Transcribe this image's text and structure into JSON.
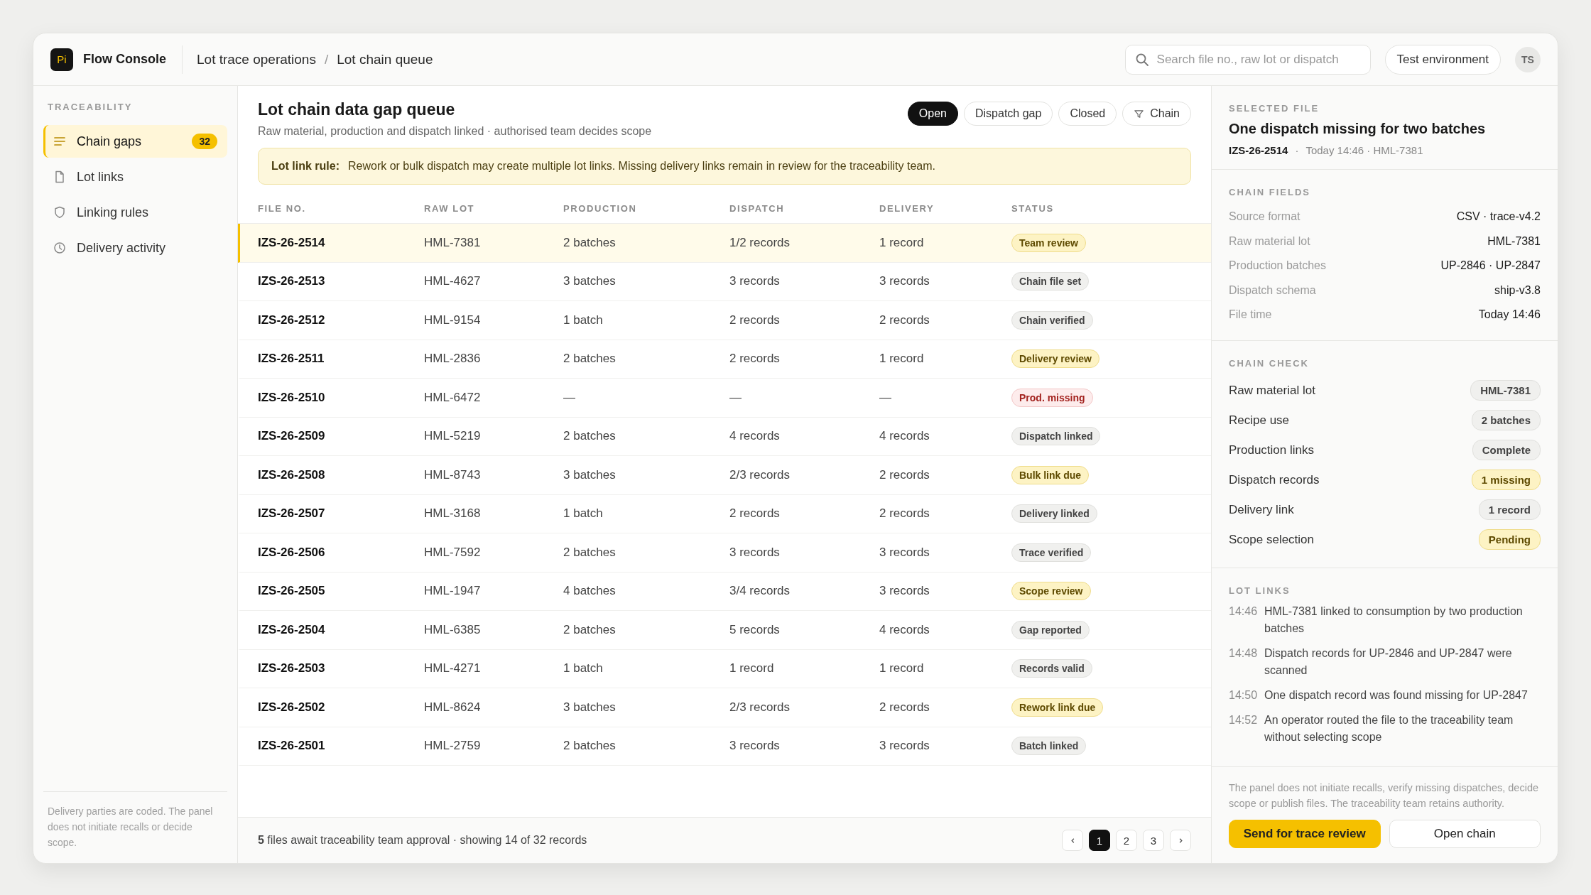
{
  "app": {
    "logo": "Pi",
    "name": "Flow Console"
  },
  "breadcrumb": {
    "separator": "/",
    "items": [
      "Lot trace operations",
      "Lot chain queue"
    ]
  },
  "search": {
    "placeholder": "Search file no., raw lot or dispatch"
  },
  "environment": "Test environment",
  "avatar": "TS",
  "sidebar": {
    "heading": "TRACEABILITY",
    "items": [
      {
        "label": "Chain gaps",
        "kind": "list",
        "selected": true,
        "count": "32"
      },
      {
        "label": "Lot links",
        "kind": "file",
        "selected": false
      },
      {
        "label": "Linking rules",
        "kind": "shield",
        "selected": false
      },
      {
        "label": "Delivery activity",
        "kind": "clock",
        "selected": false
      }
    ],
    "note": "Delivery parties are coded. The panel does not initiate recalls or decide scope."
  },
  "queue": {
    "title": "Lot chain data gap queue",
    "subtitle": "Raw material, production and dispatch linked · authorised team decides scope",
    "filters": [
      {
        "label": "Open",
        "selected": true
      },
      {
        "label": "Dispatch gap",
        "selected": false
      },
      {
        "label": "Closed",
        "selected": false
      },
      {
        "label": "Chain",
        "selected": false,
        "kind": "filter"
      }
    ],
    "rule": {
      "label": "Lot link rule:",
      "text": "Rework or bulk dispatch may create multiple lot links. Missing delivery links remain in review for the traceability team."
    }
  },
  "table": {
    "columns": [
      "FILE NO.",
      "RAW LOT",
      "PRODUCTION",
      "DISPATCH",
      "DELIVERY",
      "STATUS"
    ],
    "rows": [
      {
        "file": "IZS-26-2514",
        "lot": "HML-7381",
        "production": "2 batches",
        "dispatch": "1/2 records",
        "delivery": "1 record",
        "status": "Team review",
        "kind": "warning",
        "selected": true
      },
      {
        "file": "IZS-26-2513",
        "lot": "HML-4627",
        "production": "3 batches",
        "dispatch": "3 records",
        "delivery": "3 records",
        "status": "Chain file set",
        "kind": "neutral",
        "selected": false
      },
      {
        "file": "IZS-26-2512",
        "lot": "HML-9154",
        "production": "1 batch",
        "dispatch": "2 records",
        "delivery": "2 records",
        "status": "Chain verified",
        "kind": "neutral",
        "selected": false
      },
      {
        "file": "IZS-26-2511",
        "lot": "HML-2836",
        "production": "2 batches",
        "dispatch": "2 records",
        "delivery": "1 record",
        "status": "Delivery review",
        "kind": "warning",
        "selected": false
      },
      {
        "file": "IZS-26-2510",
        "lot": "HML-6472",
        "production": "—",
        "dispatch": "—",
        "delivery": "—",
        "status": "Prod. missing",
        "kind": "error",
        "selected": false
      },
      {
        "file": "IZS-26-2509",
        "lot": "HML-5219",
        "production": "2 batches",
        "dispatch": "4 records",
        "delivery": "4 records",
        "status": "Dispatch linked",
        "kind": "neutral",
        "selected": false
      },
      {
        "file": "IZS-26-2508",
        "lot": "HML-8743",
        "production": "3 batches",
        "dispatch": "2/3 records",
        "delivery": "2 records",
        "status": "Bulk link due",
        "kind": "warning",
        "selected": false
      },
      {
        "file": "IZS-26-2507",
        "lot": "HML-3168",
        "production": "1 batch",
        "dispatch": "2 records",
        "delivery": "2 records",
        "status": "Delivery linked",
        "kind": "neutral",
        "selected": false
      },
      {
        "file": "IZS-26-2506",
        "lot": "HML-7592",
        "production": "2 batches",
        "dispatch": "3 records",
        "delivery": "3 records",
        "status": "Trace verified",
        "kind": "neutral",
        "selected": false
      },
      {
        "file": "IZS-26-2505",
        "lot": "HML-1947",
        "production": "4 batches",
        "dispatch": "3/4 records",
        "delivery": "3 records",
        "status": "Scope review",
        "kind": "warning",
        "selected": false
      },
      {
        "file": "IZS-26-2504",
        "lot": "HML-6385",
        "production": "2 batches",
        "dispatch": "5 records",
        "delivery": "4 records",
        "status": "Gap reported",
        "kind": "neutral",
        "selected": false
      },
      {
        "file": "IZS-26-2503",
        "lot": "HML-4271",
        "production": "1 batch",
        "dispatch": "1 record",
        "delivery": "1 record",
        "status": "Records valid",
        "kind": "neutral",
        "selected": false
      },
      {
        "file": "IZS-26-2502",
        "lot": "HML-8624",
        "production": "3 batches",
        "dispatch": "2/3 records",
        "delivery": "2 records",
        "status": "Rework link due",
        "kind": "warning",
        "selected": false
      },
      {
        "file": "IZS-26-2501",
        "lot": "HML-2759",
        "production": "2 batches",
        "dispatch": "3 records",
        "delivery": "3 records",
        "status": "Batch linked",
        "kind": "neutral",
        "selected": false
      }
    ]
  },
  "footer": {
    "summary": "**5** files await traceability team approval · showing 14 of 32 records",
    "pages": [
      {
        "label": "1",
        "selected": true
      },
      {
        "label": "2",
        "selected": false
      },
      {
        "label": "3",
        "selected": false
      }
    ]
  },
  "detail": {
    "heading": "SELECTED FILE",
    "title": "One dispatch missing for two batches",
    "file": "IZS-26-2514",
    "separator": "·",
    "meta": "Today 14:46 · HML-7381",
    "fields_heading": "CHAIN FIELDS",
    "fields": [
      {
        "label": "Source format",
        "value": "CSV · trace-v4.2"
      },
      {
        "label": "Raw material lot",
        "value": "HML-7381"
      },
      {
        "label": "Production batches",
        "value": "UP-2846 · UP-2847"
      },
      {
        "label": "Dispatch schema",
        "value": "ship-v3.8"
      },
      {
        "label": "File time",
        "value": "Today 14:46"
      }
    ],
    "check_heading": "CHAIN CHECK",
    "checks": [
      {
        "label": "Raw material lot",
        "value": "HML-7381",
        "kind": "neutral"
      },
      {
        "label": "Recipe use",
        "value": "2 batches",
        "kind": "neutral"
      },
      {
        "label": "Production links",
        "value": "Complete",
        "kind": "neutral"
      },
      {
        "label": "Dispatch records",
        "value": "1 missing",
        "kind": "warning"
      },
      {
        "label": "Delivery link",
        "value": "1 record",
        "kind": "neutral"
      },
      {
        "label": "Scope selection",
        "value": "Pending",
        "kind": "warning"
      }
    ],
    "links_heading": "LOT LINKS",
    "links": [
      {
        "time": "14:46",
        "text": "HML-7381 linked to consumption by two production batches"
      },
      {
        "time": "14:48",
        "text": "Dispatch records for UP-2846 and UP-2847 were scanned"
      },
      {
        "time": "14:50",
        "text": "One dispatch record was found missing for UP-2847"
      },
      {
        "time": "14:52",
        "text": "An operator routed the file to the traceability team without selecting scope"
      }
    ],
    "disclaimer": "The panel does not initiate recalls, verify missing dispatches, decide scope or publish files. The traceability team retains authority.",
    "actions": [
      {
        "label": "Send for trace review",
        "kind": "primary"
      },
      {
        "label": "Open chain",
        "kind": "secondary"
      }
    ]
  }
}
